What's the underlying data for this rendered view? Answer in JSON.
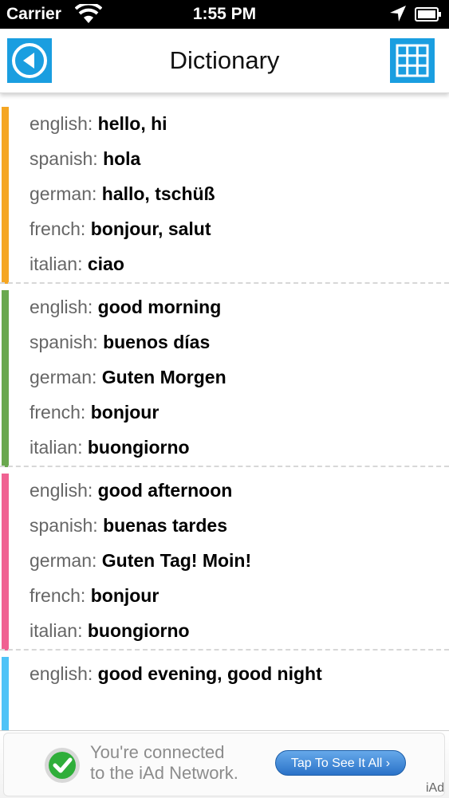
{
  "status_bar": {
    "carrier": "Carrier",
    "time": "1:55 PM"
  },
  "nav": {
    "title": "Dictionary",
    "accent_color": "#1a9ee0"
  },
  "entries": [
    {
      "color": "#f5a623",
      "rows": [
        {
          "lang": "english:",
          "word": "hello, hi"
        },
        {
          "lang": "spanish:",
          "word": "hola"
        },
        {
          "lang": "german:",
          "word": "hallo, tschüß"
        },
        {
          "lang": "french:",
          "word": "bonjour, salut"
        },
        {
          "lang": "italian:",
          "word": "ciao"
        }
      ]
    },
    {
      "color": "#6aa84f",
      "rows": [
        {
          "lang": "english:",
          "word": "good morning"
        },
        {
          "lang": "spanish:",
          "word": "buenos días"
        },
        {
          "lang": "german:",
          "word": "Guten Morgen"
        },
        {
          "lang": "french:",
          "word": "bonjour"
        },
        {
          "lang": "italian:",
          "word": "buongiorno"
        }
      ]
    },
    {
      "color": "#f06292",
      "rows": [
        {
          "lang": "english:",
          "word": "good afternoon"
        },
        {
          "lang": "spanish:",
          "word": "buenas tardes"
        },
        {
          "lang": "german:",
          "word": "Guten Tag! Moin!"
        },
        {
          "lang": "french:",
          "word": "bonjour"
        },
        {
          "lang": "italian:",
          "word": "buongiorno"
        }
      ]
    },
    {
      "color": "#4fc3f7",
      "rows": [
        {
          "lang": "english:",
          "word": "good evening, good night"
        }
      ]
    }
  ],
  "ad": {
    "line1": "You're connected",
    "line2": "to the iAd Network.",
    "button_label": "Tap To See It All",
    "button_arrow": "›",
    "network_label": "iAd"
  }
}
